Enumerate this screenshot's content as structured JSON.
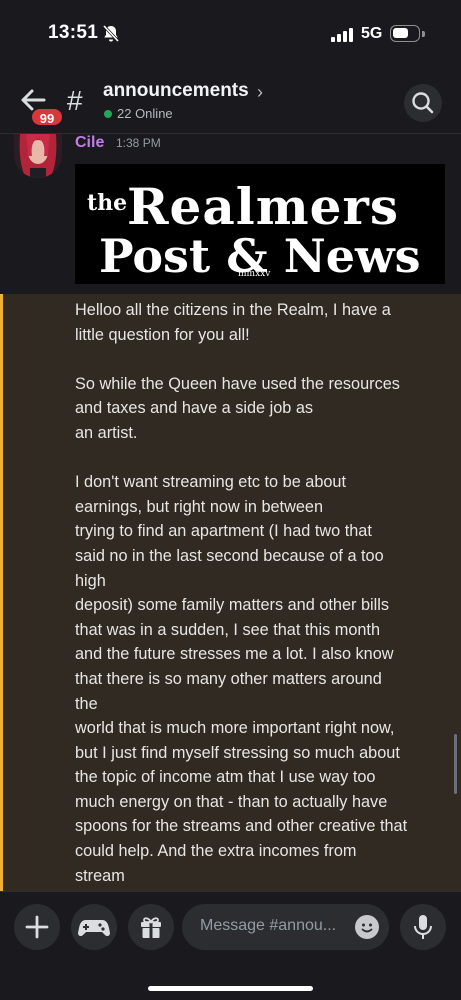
{
  "status": {
    "time": "13:51",
    "network": "5G"
  },
  "header": {
    "badge": "99",
    "hash": "#",
    "channel": "announcements",
    "online": "22 Online"
  },
  "message": {
    "author": "Cile",
    "time": "1:38 PM",
    "banner": {
      "prefix": "the",
      "line1": "Realmers",
      "line2": "Post & News",
      "year": "mmxxv"
    },
    "body": "Helloo all the citizens in the Realm, I have a\nlittle question for you all!\n\nSo while the Queen have used the resources\nand taxes and have a side job as\nan artist.\n\nI don't want streaming etc to be about\nearnings, but right now in between\ntrying to find an apartment (I had two that\nsaid no in the last second because of a too\nhigh\ndeposit) some family matters and other bills\nthat was in a sudden, I see that this month\nand the future stresses me a lot. I also know\nthat there is so many other matters around\nthe\nworld that is much more important right now,\nbut I just find myself stressing so much about\nthe topic of income atm that I use way too\nmuch energy on that - than to actually have\nspoons for the streams and other creative that\ncould help. And the extra incomes from\nstream"
  },
  "composer": {
    "placeholder": "Message #annou..."
  },
  "colors": {
    "author": "#c27ce8",
    "highlight_bar": "#f0b232",
    "badge": "#da373c",
    "online": "#23a55a"
  },
  "icons": [
    "bell-slash-icon",
    "signal-icon",
    "battery-icon",
    "back-arrow-icon",
    "hash-icon",
    "chevron-right-icon",
    "search-icon",
    "plus-icon",
    "gamepad-icon",
    "gift-icon",
    "emoji-icon",
    "microphone-icon"
  ]
}
